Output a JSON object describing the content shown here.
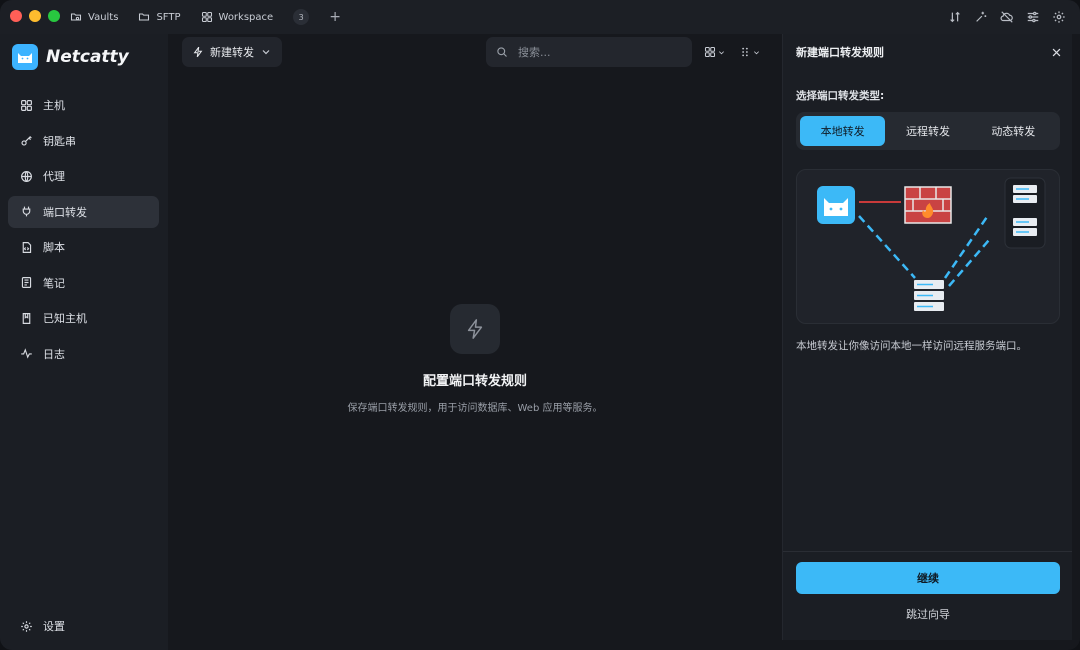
{
  "titlebar": {
    "tabs": [
      {
        "label": "Vaults",
        "icon": "folder-cloud-icon"
      },
      {
        "label": "SFTP",
        "icon": "folder-icon"
      },
      {
        "label": "Workspace",
        "icon": "grid-icon"
      }
    ],
    "tab_count": "3",
    "new_tab": "+"
  },
  "brand": {
    "name": "Netcatty"
  },
  "sidebar": {
    "items": [
      {
        "label": "主机",
        "icon": "grid-icon"
      },
      {
        "label": "钥匙串",
        "icon": "key-icon"
      },
      {
        "label": "代理",
        "icon": "globe-icon"
      },
      {
        "label": "端口转发",
        "icon": "plug-icon",
        "active": true
      },
      {
        "label": "脚本",
        "icon": "script-icon"
      },
      {
        "label": "笔记",
        "icon": "note-icon"
      },
      {
        "label": "已知主机",
        "icon": "book-icon"
      },
      {
        "label": "日志",
        "icon": "activity-icon"
      }
    ],
    "settings_label": "设置"
  },
  "main": {
    "new_button": "新建转发",
    "search_placeholder": "搜索...",
    "empty_title": "配置端口转发规则",
    "empty_subtitle": "保存端口转发规则，用于访问数据库、Web 应用等服务。"
  },
  "panel": {
    "title": "新建端口转发规则",
    "type_label": "选择端口转发类型:",
    "types": [
      "本地转发",
      "远程转发",
      "动态转发"
    ],
    "active_type": 0,
    "description": "本地转发让你像访问本地一样访问远程服务端口。",
    "continue_label": "继续",
    "skip_label": "跳过向导"
  },
  "colors": {
    "accent": "#3cb9f7",
    "window_bg": "#16181d",
    "sidebar_bg": "#1b1e24",
    "active_item_bg": "#2d3139"
  }
}
